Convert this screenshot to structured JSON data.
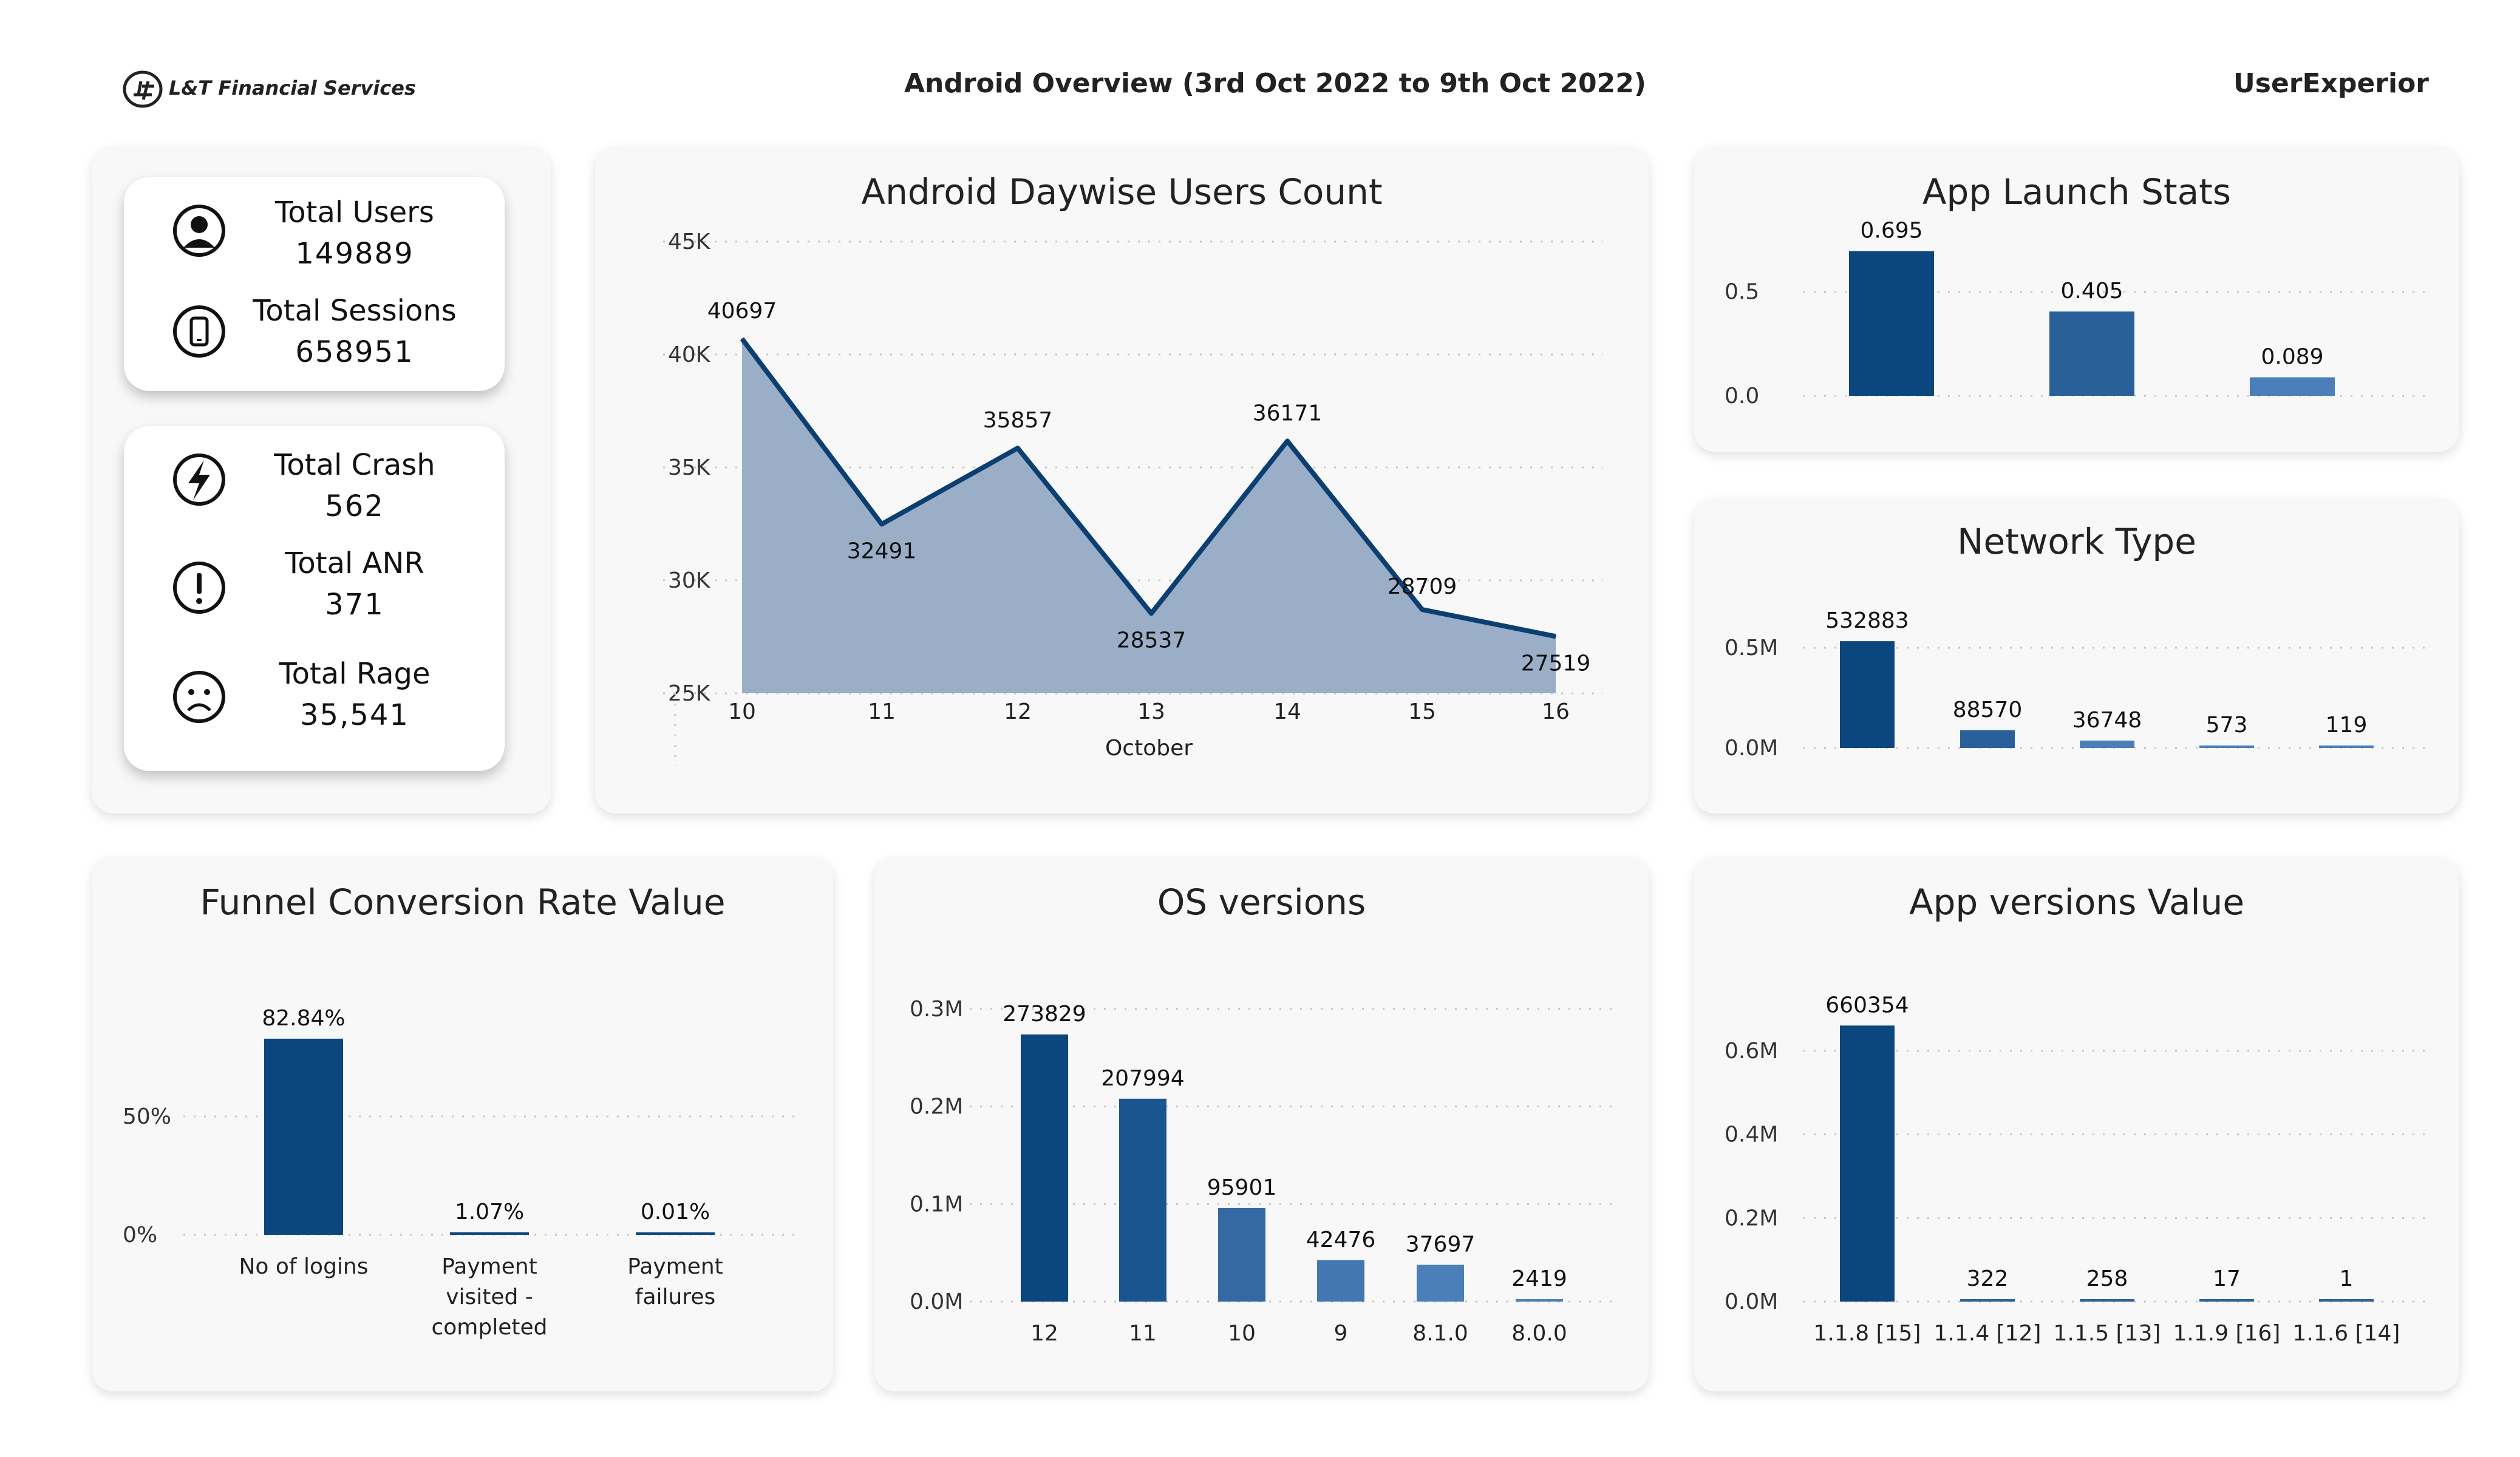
{
  "header": {
    "brand": "L&T Financial Services",
    "title": "Android Overview (3rd Oct 2022 to 9th Oct 2022)",
    "right_label": "UserExperior"
  },
  "kpis": [
    {
      "label": "Total Users",
      "value": "149889",
      "icon": "user-icon"
    },
    {
      "label": "Total Sessions",
      "value": "658951",
      "icon": "phone-icon"
    },
    {
      "label": "Total Crash",
      "value": "562",
      "icon": "lightning-icon"
    },
    {
      "label": "Total ANR",
      "value": "371",
      "icon": "exclamation-icon"
    },
    {
      "label": "Total Rage",
      "value": "35,541",
      "icon": "frown-icon"
    }
  ],
  "colors": {
    "dark": "#0b467f",
    "mid": "#2a609a",
    "light": "#4a7fb9",
    "area": "#9aaec8",
    "line": "#0b3f72"
  },
  "chart_data": [
    {
      "type": "area",
      "title": "Android Daywise Users Count",
      "x": [
        "10",
        "11",
        "12",
        "13",
        "14",
        "15",
        "16"
      ],
      "values": [
        40697,
        32491,
        35857,
        28537,
        36171,
        28709,
        27519
      ],
      "xlabel": "October",
      "ylabel": "",
      "ylim": [
        25000,
        45000
      ],
      "yticks": [
        "25K",
        "30K",
        "35K",
        "40K",
        "45K"
      ]
    },
    {
      "type": "bar",
      "title": "App Launch Stats",
      "categories": [
        "",
        "",
        ""
      ],
      "values": [
        0.695,
        0.405,
        0.089
      ],
      "ylim": [
        0,
        0.7
      ],
      "yticks": [
        "0.0",
        "0.5"
      ]
    },
    {
      "type": "bar",
      "title": "Network Type",
      "categories": [
        "",
        "",
        "",
        "",
        ""
      ],
      "values": [
        532883,
        88570,
        36748,
        573,
        119
      ],
      "ylim": [
        0,
        600000
      ],
      "yticks": [
        "0.0M",
        "0.5M"
      ]
    },
    {
      "type": "bar",
      "title": "Funnel Conversion Rate Value",
      "categories": [
        "No of logins",
        "Payment visited - completed",
        "Payment failures"
      ],
      "values": [
        82.84,
        1.07,
        0.01
      ],
      "value_labels": [
        "82.84%",
        "1.07%",
        "0.01%"
      ],
      "ylim": [
        0,
        100
      ],
      "yticks": [
        "0%",
        "50%"
      ]
    },
    {
      "type": "bar",
      "title": "OS versions",
      "categories": [
        "12",
        "11",
        "10",
        "9",
        "8.1.0",
        "8.0.0"
      ],
      "values": [
        273829,
        207994,
        95901,
        42476,
        37697,
        2419
      ],
      "ylim": [
        0,
        300000
      ],
      "yticks": [
        "0.0M",
        "0.1M",
        "0.2M",
        "0.3M"
      ]
    },
    {
      "type": "bar",
      "title": "App versions Value",
      "categories": [
        "1.1.8 [15]",
        "1.1.4 [12]",
        "1.1.5 [13]",
        "1.1.9 [16]",
        "1.1.6 [14]"
      ],
      "values": [
        660354,
        322,
        258,
        17,
        1
      ],
      "ylim": [
        0,
        700000
      ],
      "yticks": [
        "0.0M",
        "0.2M",
        "0.4M",
        "0.6M"
      ]
    }
  ]
}
